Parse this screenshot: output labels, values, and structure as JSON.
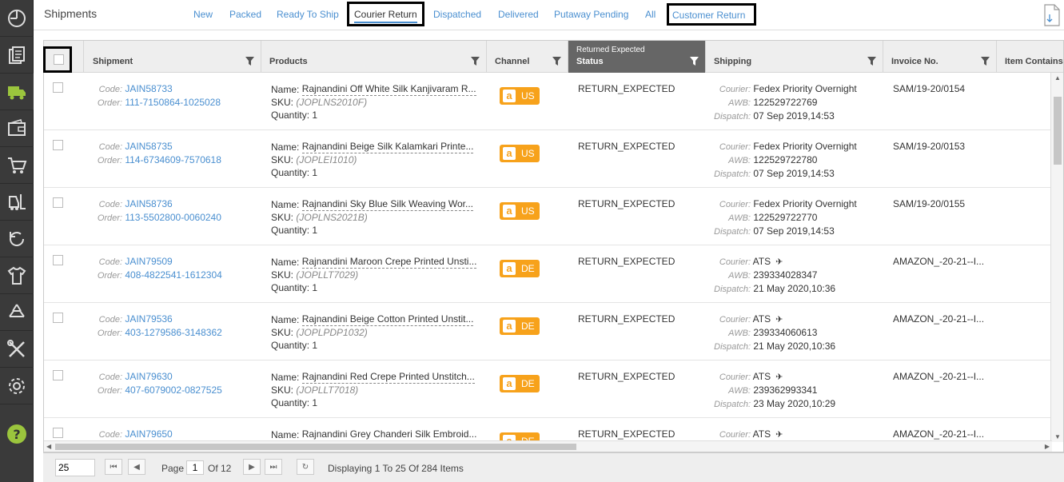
{
  "header": {
    "title": "Shipments",
    "tabs": [
      {
        "label": "New"
      },
      {
        "label": "Packed"
      },
      {
        "label": "Ready To Ship"
      },
      {
        "label": "Courier Return"
      },
      {
        "label": "Dispatched"
      },
      {
        "label": "Delivered"
      },
      {
        "label": "Putaway Pending"
      },
      {
        "label": "All"
      },
      {
        "label": "Customer Return"
      }
    ],
    "active_tab": "Courier Return"
  },
  "grid": {
    "columns": {
      "shipment": "Shipment",
      "products": "Products",
      "channel": "Channel",
      "status_sub": "Returned Expected",
      "status": "Status",
      "shipping": "Shipping",
      "invoice": "Invoice No.",
      "item_contains": "Item Contains"
    },
    "labels": {
      "code": "Code:",
      "order": "Order:",
      "name": "Name:",
      "sku": "SKU:",
      "quantity": "Quantity:",
      "courier": "Courier:",
      "awb": "AWB:",
      "dispatch": "Dispatch:"
    },
    "rows": [
      {
        "code": "JAIN58733",
        "order": "111-7150864-1025028",
        "name": "Rajnandini Off White Silk Kanjivaram R...",
        "sku": "(JOPLNS2010F)",
        "qty": "1",
        "channel_glyph": "a",
        "channel": "US",
        "status": "RETURN_EXPECTED",
        "courier": "Fedex Priority Overnight",
        "awb": "122529722769",
        "dispatch": "07 Sep 2019,14:53",
        "invoice": "SAM/19-20/0154"
      },
      {
        "code": "JAIN58735",
        "order": "114-6734609-7570618",
        "name": "Rajnandini Beige Silk Kalamkari Printe...",
        "sku": "(JOPLEI1010)",
        "qty": "1",
        "channel_glyph": "a",
        "channel": "US",
        "status": "RETURN_EXPECTED",
        "courier": "Fedex Priority Overnight",
        "awb": "122529722780",
        "dispatch": "07 Sep 2019,14:53",
        "invoice": "SAM/19-20/0153"
      },
      {
        "code": "JAIN58736",
        "order": "113-5502800-0060240",
        "name": "Rajnandini Sky Blue Silk Weaving Wor...",
        "sku": "(JOPLNS2021B)",
        "qty": "1",
        "channel_glyph": "a",
        "channel": "US",
        "status": "RETURN_EXPECTED",
        "courier": "Fedex Priority Overnight",
        "awb": "122529722770",
        "dispatch": "07 Sep 2019,14:53",
        "invoice": "SAM/19-20/0155"
      },
      {
        "code": "JAIN79509",
        "order": "408-4822541-1612304",
        "name": "Rajnandini Maroon Crepe Printed Unsti...",
        "sku": "(JOPLLT7029)",
        "qty": "1",
        "channel_glyph": "a",
        "channel": "DE",
        "status": "RETURN_EXPECTED",
        "courier": "ATS",
        "awb": "239334028347",
        "dispatch": "21 May 2020,10:36",
        "invoice": "AMAZON_-20-21--I..."
      },
      {
        "code": "JAIN79536",
        "order": "403-1279586-3148362",
        "name": "Rajnandini Beige Cotton Printed Unstit...",
        "sku": "(JOPLPDP1032)",
        "qty": "1",
        "channel_glyph": "a",
        "channel": "DE",
        "status": "RETURN_EXPECTED",
        "courier": "ATS",
        "awb": "239334060613",
        "dispatch": "21 May 2020,10:36",
        "invoice": "AMAZON_-20-21--I..."
      },
      {
        "code": "JAIN79630",
        "order": "407-6079002-0827525",
        "name": "Rajnandini Red Crepe Printed Unstitch...",
        "sku": "(JOPLLT7018)",
        "qty": "1",
        "channel_glyph": "a",
        "channel": "DE",
        "status": "RETURN_EXPECTED",
        "courier": "ATS",
        "awb": "239362993341",
        "dispatch": "23 May 2020,10:29",
        "invoice": "AMAZON_-20-21--I..."
      },
      {
        "code": "JAIN79650",
        "order": "",
        "name": "Rajnandini Grey Chanderi Silk Embroid...",
        "sku": "",
        "qty": "",
        "channel_glyph": "a",
        "channel": "DE",
        "status": "RETURN_EXPECTED",
        "courier": "ATS",
        "awb": "",
        "dispatch": "",
        "invoice": "AMAZON_-20-21--I..."
      }
    ]
  },
  "pager": {
    "page_size": "25",
    "page_label": "Page",
    "page": "1",
    "of_label": "Of 12",
    "display_text": "Displaying 1 To 25 Of 284 Items"
  },
  "colors": {
    "accent": "#4a8fd0",
    "channel_badge": "#f7a21b",
    "rail": "#3a3a3a",
    "help": "#9bc53d"
  }
}
